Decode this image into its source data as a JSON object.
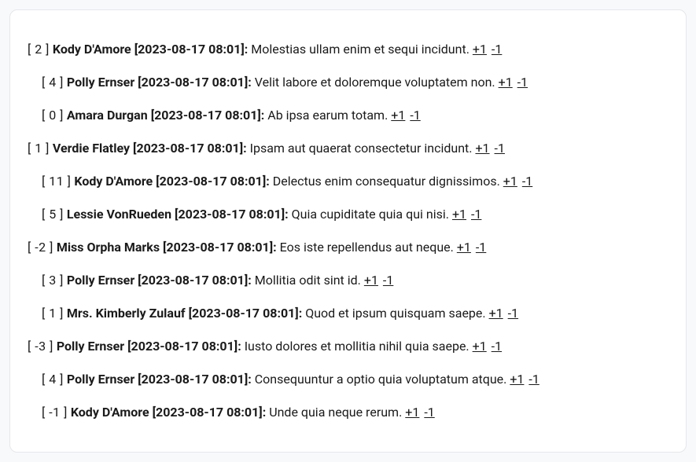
{
  "vote_up_label": "+1",
  "vote_down_label": "-1",
  "threads": [
    {
      "score": "[ 2 ]",
      "author": "Kody D'Amore",
      "timestamp": "[2023-08-17 08:01]:",
      "text": "Molestias ullam enim et sequi incidunt.",
      "replies": [
        {
          "score": "[ 4 ]",
          "author": "Polly Ernser",
          "timestamp": "[2023-08-17 08:01]:",
          "text": "Velit labore et doloremque voluptatem non."
        },
        {
          "score": "[ 0 ]",
          "author": "Amara Durgan",
          "timestamp": "[2023-08-17 08:01]:",
          "text": "Ab ipsa earum totam."
        }
      ]
    },
    {
      "score": "[ 1 ]",
      "author": "Verdie Flatley",
      "timestamp": "[2023-08-17 08:01]:",
      "text": "Ipsam aut quaerat consectetur incidunt.",
      "replies": [
        {
          "score": "[ 11 ]",
          "author": "Kody D'Amore",
          "timestamp": "[2023-08-17 08:01]:",
          "text": "Delectus enim consequatur dignissimos."
        },
        {
          "score": "[ 5 ]",
          "author": "Lessie VonRueden",
          "timestamp": "[2023-08-17 08:01]:",
          "text": "Quia cupiditate quia qui nisi."
        }
      ]
    },
    {
      "score": "[ -2 ]",
      "author": "Miss Orpha Marks",
      "timestamp": "[2023-08-17 08:01]:",
      "text": "Eos iste repellendus aut neque.",
      "replies": [
        {
          "score": "[ 3 ]",
          "author": "Polly Ernser",
          "timestamp": "[2023-08-17 08:01]:",
          "text": "Mollitia odit sint id."
        },
        {
          "score": "[ 1 ]",
          "author": "Mrs. Kimberly Zulauf",
          "timestamp": "[2023-08-17 08:01]:",
          "text": "Quod et ipsum quisquam saepe."
        }
      ]
    },
    {
      "score": "[ -3 ]",
      "author": "Polly Ernser",
      "timestamp": "[2023-08-17 08:01]:",
      "text": "Iusto dolores et mollitia nihil quia saepe.",
      "replies": [
        {
          "score": "[ 4 ]",
          "author": "Polly Ernser",
          "timestamp": "[2023-08-17 08:01]:",
          "text": "Consequuntur a optio quia voluptatum atque."
        },
        {
          "score": "[ -1 ]",
          "author": "Kody D'Amore",
          "timestamp": "[2023-08-17 08:01]:",
          "text": "Unde quia neque rerum."
        }
      ]
    }
  ]
}
